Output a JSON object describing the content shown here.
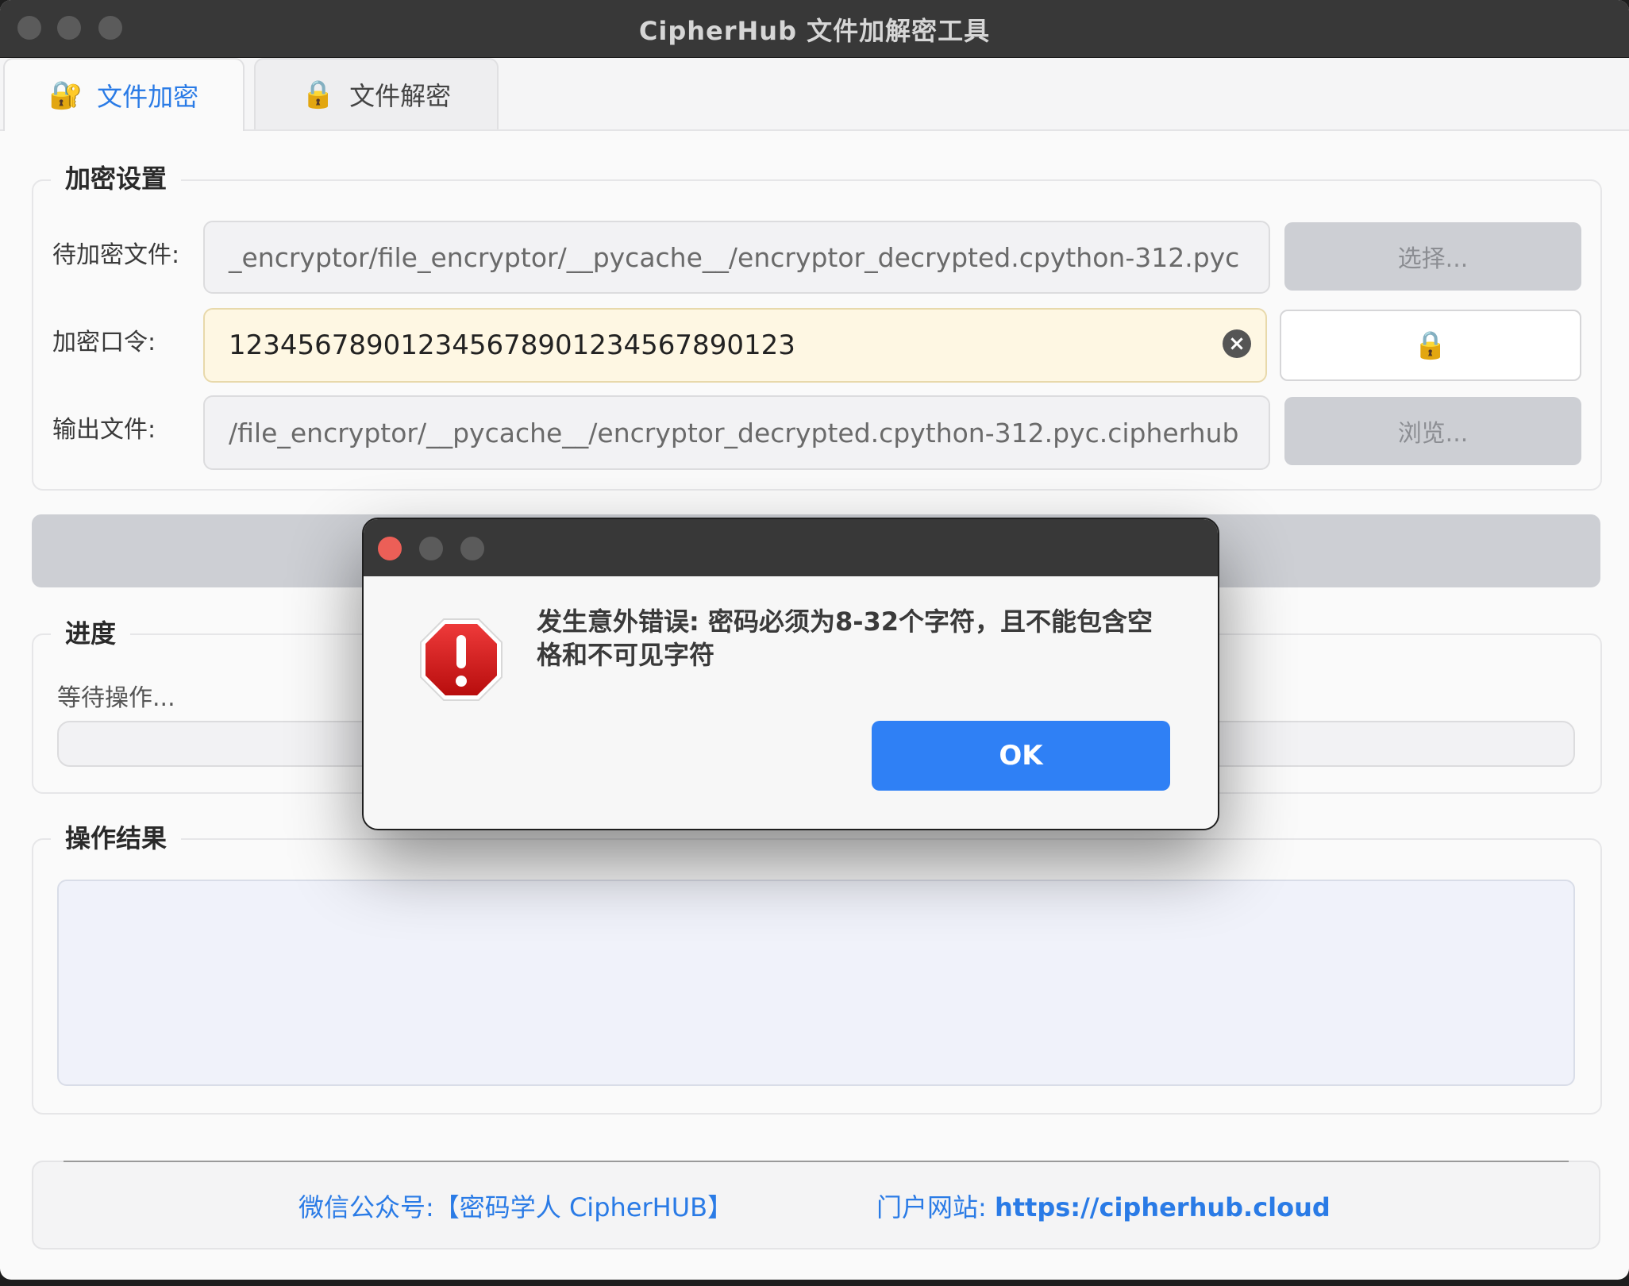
{
  "window": {
    "title": "CipherHub 文件加解密工具"
  },
  "tabs": [
    {
      "label": "文件加密",
      "icon": "lock-key-icon",
      "active": true
    },
    {
      "label": "文件解密",
      "icon": "lock-icon",
      "active": false
    }
  ],
  "encrypt_settings": {
    "title": "加密设置",
    "input_file_label": "待加密文件:",
    "input_file_value": "_encryptor/file_encryptor/__pycache__/encryptor_decrypted.cpython-312.pyc",
    "select_button": "选择...",
    "password_label": "加密口令:",
    "password_value": "12345678901234567890123456789012​3",
    "password_display": "123456789012345678901234567890123",
    "output_file_label": "输出文件:",
    "output_file_value": "/file_encryptor/__pycache__/encryptor_decrypted.cpython-312.pyc.cipherhub",
    "browse_button": "浏览..."
  },
  "progress": {
    "title": "进度",
    "status": "等待操作..."
  },
  "result": {
    "title": "操作结果"
  },
  "footer": {
    "wechat_label": "微信公众号:【密码学人 CipherHUB】",
    "site_label": "门户网站: ",
    "site_url": "https://cipherhub.cloud"
  },
  "dialog": {
    "message": "发生意外错误: 密码必须为8-32个字符，且不能包含空格和不可见字符",
    "ok_button": "OK"
  },
  "colors": {
    "accent": "#2a7be6",
    "ok_button": "#2f80f5",
    "password_bg": "#fef7e3",
    "error_red": "#d42020"
  }
}
